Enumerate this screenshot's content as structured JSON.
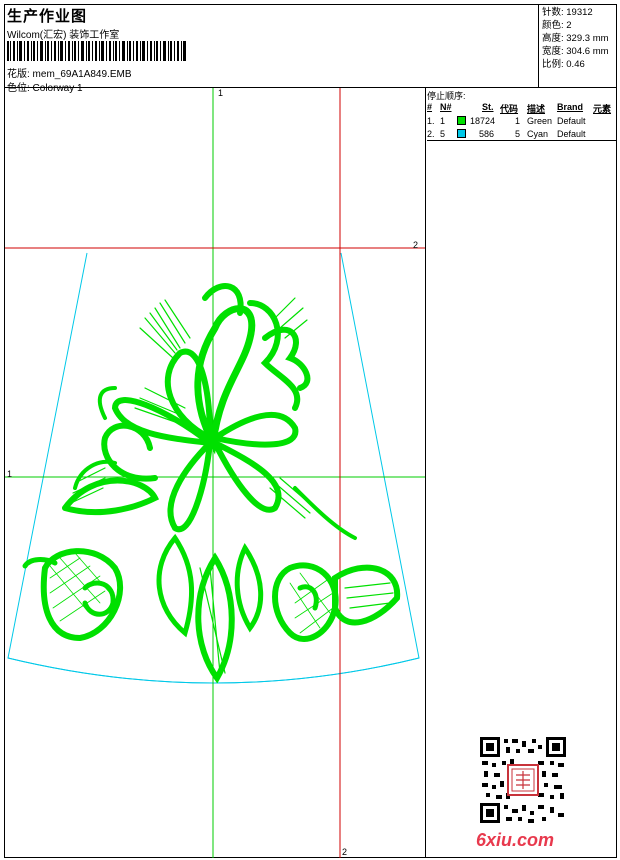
{
  "header": {
    "title": "生产作业图",
    "studio": "Wilcom(汇宏) 装饰工作室",
    "design_line": "花版: mem_69A1A849.EMB",
    "colorway_line": "色位: Colorway 1"
  },
  "stats": {
    "stitches": "针数: 19312",
    "colors": "颜色: 2",
    "height": "高度: 329.3 mm",
    "width": "宽度: 304.6 mm",
    "scale": "比例: 0.46"
  },
  "sequence": {
    "title": "停止顺序:",
    "headers": [
      "#",
      "N#",
      "St.",
      "代码",
      "描述",
      "Brand",
      "元素"
    ],
    "rows": [
      {
        "idx": "1.",
        "n": "1",
        "st": "18724",
        "code": "1",
        "desc": "Green",
        "brand": "Default",
        "color": "#00e000"
      },
      {
        "idx": "2.",
        "n": "5",
        "st": "586",
        "code": "5",
        "desc": "Cyan",
        "brand": "Default",
        "color": "#00c8e8"
      }
    ]
  },
  "canvas": {
    "axis_labels": {
      "top_green": "1",
      "left_green": "1",
      "right_red": "2",
      "bottom_red": "2"
    },
    "colors": {
      "green": "#00e000",
      "red": "#d00000",
      "cyan": "#00c8e8",
      "grid_green": "#00cc00"
    }
  },
  "watermark": {
    "text": "6xiu.com",
    "color": "#e8394d"
  }
}
